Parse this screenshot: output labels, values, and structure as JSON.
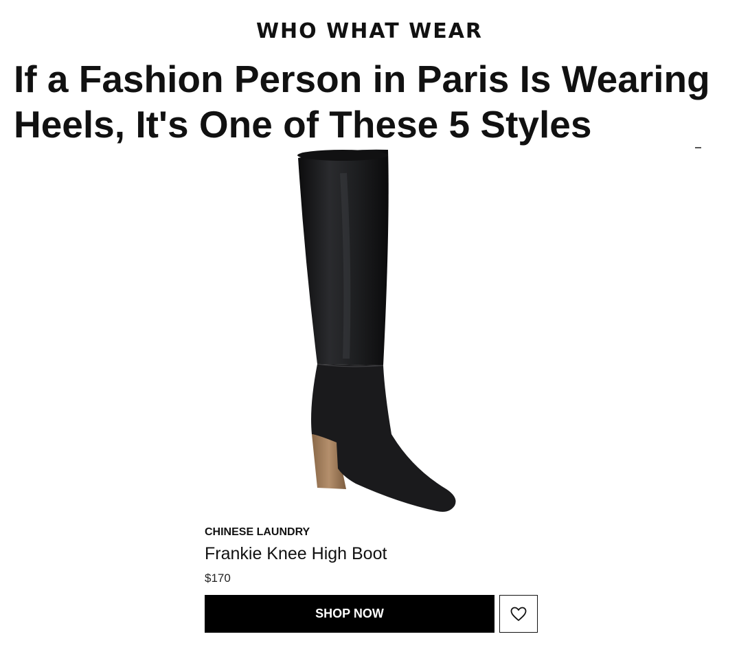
{
  "site": {
    "brand": "WHO WHAT WEAR"
  },
  "article": {
    "headline_line1": "If a Fashion Person in Paris Is Wearing",
    "headline_line2": "Heels, It's One of These 5 Styles"
  },
  "product": {
    "image_icon": "knee-high-boot-image",
    "brand": "CHINESE LAUNDRY",
    "name": "Frankie Knee High Boot",
    "price": "$170",
    "shop_label": "SHOP NOW",
    "wishlist_icon": "heart-icon"
  },
  "colors": {
    "text": "#111111",
    "button_bg": "#000000",
    "button_text": "#ffffff",
    "boot": "#1c1c1e",
    "heel": "#a17d5a"
  }
}
